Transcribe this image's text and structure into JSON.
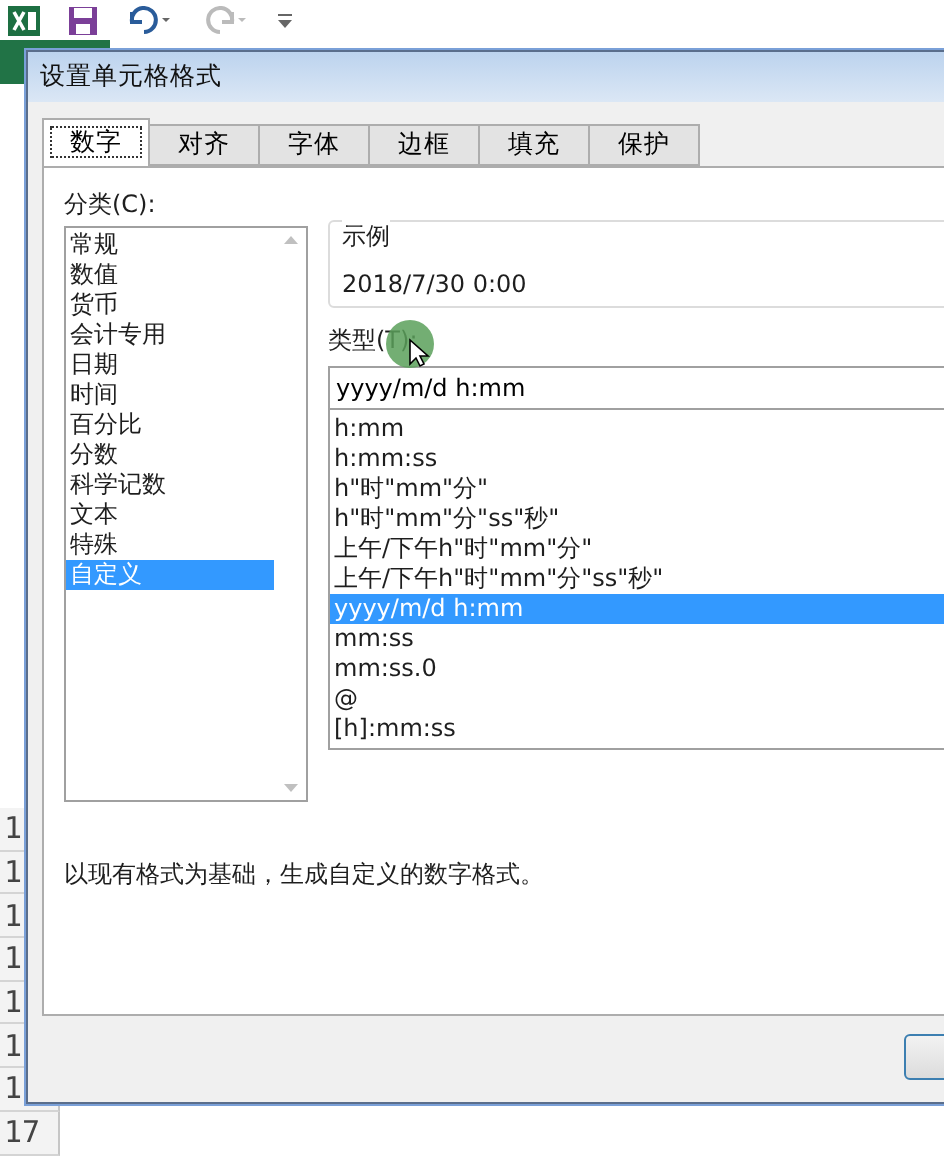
{
  "sheet": {
    "row_headers": [
      "1",
      "1",
      "1",
      "1",
      "1",
      "1",
      "1",
      "17"
    ]
  },
  "dialog": {
    "title": "设置单元格格式",
    "tabs": [
      {
        "label": "数字",
        "selected": true
      },
      {
        "label": "对齐",
        "selected": false
      },
      {
        "label": "字体",
        "selected": false
      },
      {
        "label": "边框",
        "selected": false
      },
      {
        "label": "填充",
        "selected": false
      },
      {
        "label": "保护",
        "selected": false
      }
    ],
    "category_label": "分类(C):",
    "categories": [
      {
        "label": "常规",
        "selected": false
      },
      {
        "label": "数值",
        "selected": false
      },
      {
        "label": "货币",
        "selected": false
      },
      {
        "label": "会计专用",
        "selected": false
      },
      {
        "label": "日期",
        "selected": false
      },
      {
        "label": "时间",
        "selected": false
      },
      {
        "label": "百分比",
        "selected": false
      },
      {
        "label": "分数",
        "selected": false
      },
      {
        "label": "科学记数",
        "selected": false
      },
      {
        "label": "文本",
        "selected": false
      },
      {
        "label": "特殊",
        "selected": false
      },
      {
        "label": "自定义",
        "selected": true
      }
    ],
    "sample_label": "示例",
    "sample_value": "2018/7/30 0:00",
    "type_label": "类型(T):",
    "type_value": "yyyy/m/d h:mm",
    "formats": [
      {
        "label": "h:mm",
        "selected": false
      },
      {
        "label": "h:mm:ss",
        "selected": false
      },
      {
        "label": "h\"时\"mm\"分\"",
        "selected": false
      },
      {
        "label": "h\"时\"mm\"分\"ss\"秒\"",
        "selected": false
      },
      {
        "label": "上午/下午h\"时\"mm\"分\"",
        "selected": false
      },
      {
        "label": "上午/下午h\"时\"mm\"分\"ss\"秒\"",
        "selected": false
      },
      {
        "label": "yyyy/m/d h:mm",
        "selected": true
      },
      {
        "label": "mm:ss",
        "selected": false
      },
      {
        "label": "mm:ss.0",
        "selected": false
      },
      {
        "label": "@",
        "selected": false
      },
      {
        "label": "[h]:mm:ss",
        "selected": false
      }
    ],
    "description": "以现有格式为基础，生成自定义的数字格式。"
  }
}
